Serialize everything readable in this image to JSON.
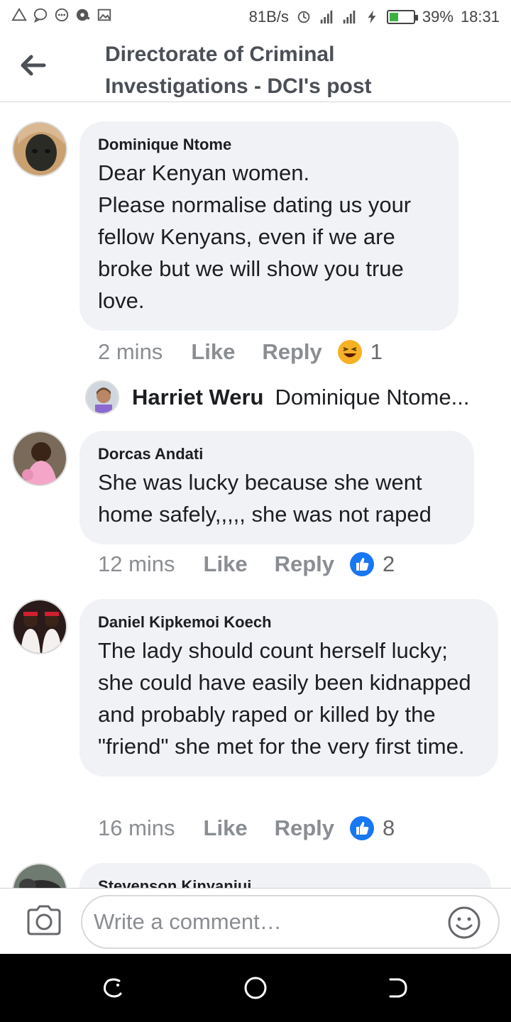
{
  "status_bar": {
    "net_speed": "81B/s",
    "battery_percent": "39%",
    "time": "18:31",
    "battery_level": 0.39,
    "left_icons": [
      "warning-icon",
      "chat-icon",
      "messenger-icon",
      "notification-icon",
      "gallery-icon"
    ],
    "right_icons": [
      "sync-icon",
      "signal-icon",
      "signal-icon",
      "charging-icon"
    ]
  },
  "header": {
    "title": "Directorate of Criminal Investigations - DCI's post",
    "back_icon": "arrow-left-icon"
  },
  "comments": [
    {
      "author": "Dominique Ntome",
      "text": "Dear Kenyan women.\nPlease normalise dating us your fellow Kenyans, even if we are broke but we will show you true love.",
      "time": "2 mins",
      "like": "Like",
      "reply": "Reply",
      "reaction_icon": "haha-reaction-icon",
      "reaction_count": "1"
    },
    {
      "author": "Dorcas Andati",
      "text": "She was lucky because she  went home safely,,,,, she was not raped",
      "time": "12 mins",
      "like": "Like",
      "reply": "Reply",
      "reaction_icon": "thumbs-up-reaction-icon",
      "reaction_count": "2"
    },
    {
      "author": "Daniel Kipkemoi Koech",
      "text": "The lady should count herself lucky; she could have easily been kidnapped and probably raped or killed by the \"friend\" she met for the very first time.",
      "time": "16 mins",
      "like": "Like",
      "reply": "Reply",
      "reaction_icon": "thumbs-up-reaction-icon",
      "reaction_count": "8"
    },
    {
      "author": "Stevenson Kinyanjui"
    }
  ],
  "reply_preview": {
    "name": "Harriet Weru",
    "text": "Dominique Ntome..."
  },
  "composer": {
    "placeholder": "Write a comment…",
    "camera_icon": "camera-icon",
    "emoji_icon": "smiley-icon"
  },
  "navbar": {
    "icons": [
      "recents-icon",
      "home-icon",
      "back-icon"
    ]
  },
  "colors": {
    "bubble": "#f0f2f5",
    "meta_text": "#8a8d91",
    "thumbs_up": "#1877f2",
    "haha": "#f7b125"
  }
}
